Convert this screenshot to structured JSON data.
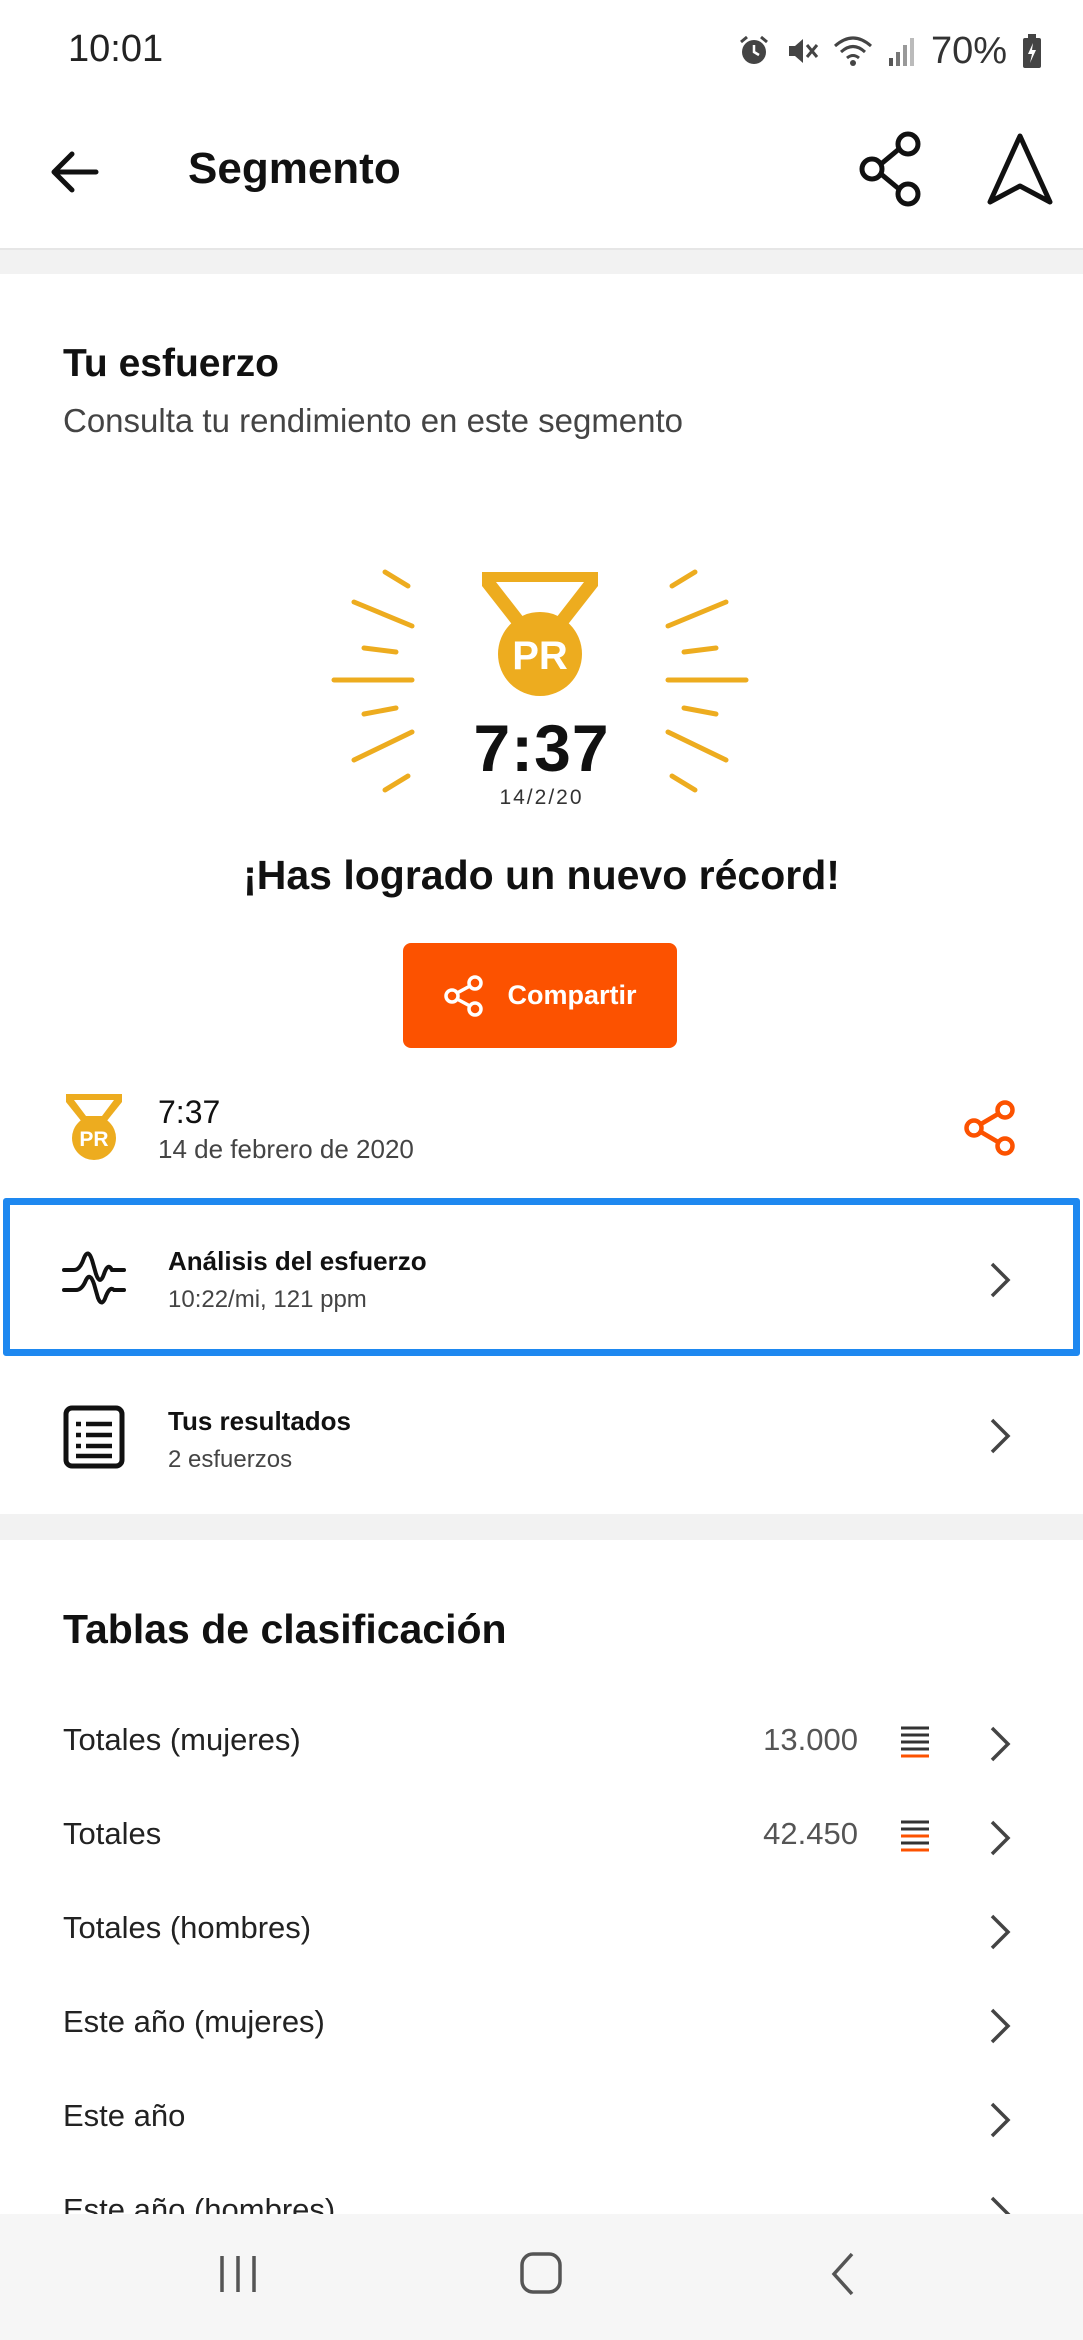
{
  "status_bar": {
    "time": "10:01",
    "battery": "70%"
  },
  "app_bar": {
    "title": "Segmento"
  },
  "effort": {
    "title": "Tu esfuerzo",
    "subtitle": "Consulta tu rendimiento en este segmento",
    "badge_text": "PR",
    "pr_time": "7:37",
    "pr_date": "14/2/20",
    "headline": "¡Has logrado un nuevo récord!",
    "share_label": "Compartir",
    "pr_row": {
      "time": "7:37",
      "date": "14 de febrero de 2020",
      "badge_text": "PR"
    },
    "analysis": {
      "title": "Análisis del esfuerzo",
      "detail": "10:22/mi, 121 ppm"
    },
    "results": {
      "title": "Tus resultados",
      "detail": "2 esfuerzos"
    }
  },
  "leaderboards": {
    "title": "Tablas de clasificación",
    "rows": [
      {
        "label": "Totales (mujeres)",
        "count": "13.000"
      },
      {
        "label": "Totales",
        "count": "42.450"
      },
      {
        "label": "Totales (hombres)",
        "count": ""
      },
      {
        "label": "Este año (mujeres)",
        "count": ""
      },
      {
        "label": "Este año",
        "count": ""
      },
      {
        "label": "Este año (hombres)",
        "count": ""
      }
    ]
  },
  "colors": {
    "accent": "#fc5200",
    "gold": "#edac1f",
    "highlight": "#1e88f0"
  },
  "icons": [
    "alarm-icon",
    "mute-icon",
    "wifi-icon",
    "signal-icon",
    "battery-icon",
    "back-arrow-icon",
    "share-icon",
    "navigate-icon",
    "pr-medal-icon",
    "effort-analysis-icon",
    "results-list-icon",
    "chevron-right-icon",
    "leaderboard-icon",
    "recent-apps-icon",
    "home-icon",
    "system-back-icon"
  ]
}
